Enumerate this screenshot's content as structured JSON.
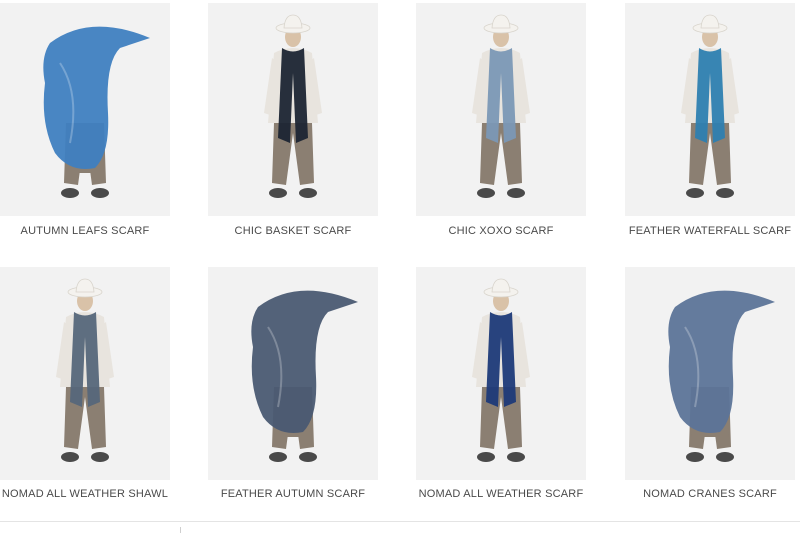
{
  "products": [
    {
      "name": "AUTUMN LEAFS SCARF",
      "scarf_color": "#3f7fc0",
      "pose": "flying",
      "icon": "model-photo"
    },
    {
      "name": "CHIC BASKET SCARF",
      "scarf_color": "#1c2533",
      "pose": "hat",
      "icon": "model-photo"
    },
    {
      "name": "CHIC XOXO SCARF",
      "scarf_color": "#7b98b5",
      "pose": "hat",
      "icon": "model-photo"
    },
    {
      "name": "FEATHER WATERFALL SCARF",
      "scarf_color": "#2e7fb0",
      "pose": "hat",
      "icon": "model-photo"
    },
    {
      "name": "NOMAD ALL WEATHER SHAWL",
      "scarf_color": "#56677a",
      "pose": "hat",
      "icon": "model-photo"
    },
    {
      "name": "FEATHER AUTUMN SCARF",
      "scarf_color": "#4a5a72",
      "pose": "flying",
      "icon": "model-photo"
    },
    {
      "name": "NOMAD ALL WEATHER SCARF",
      "scarf_color": "#1e3a78",
      "pose": "hat",
      "icon": "model-photo"
    },
    {
      "name": "NOMAD CRANES SCARF",
      "scarf_color": "#5c7498",
      "pose": "flying",
      "icon": "model-photo"
    }
  ],
  "colors": {
    "photo_bg": "#f2f2f2",
    "pants": "#8b7f72",
    "shirt": "#e8e4de",
    "hat": "#f4f2ee",
    "shoes": "#4a4a4a"
  }
}
